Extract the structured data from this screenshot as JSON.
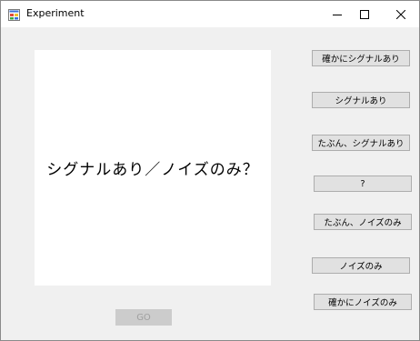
{
  "window": {
    "title": "Experiment"
  },
  "stimulus": {
    "text": "シグナルあり／ノイズのみ？"
  },
  "responses": [
    {
      "label": "確かにシグナルあり"
    },
    {
      "label": "シグナルあり"
    },
    {
      "label": "たぶん、シグナルあり"
    },
    {
      "label": "?"
    },
    {
      "label": "たぶん、ノイズのみ"
    },
    {
      "label": "ノイズのみ"
    },
    {
      "label": "確かにノイズのみ"
    }
  ],
  "go_button": {
    "label": "GO",
    "enabled": false
  },
  "icons": {
    "app": "app-window-icon",
    "minimize": "minimize-icon",
    "maximize": "maximize-icon",
    "close": "close-icon"
  }
}
